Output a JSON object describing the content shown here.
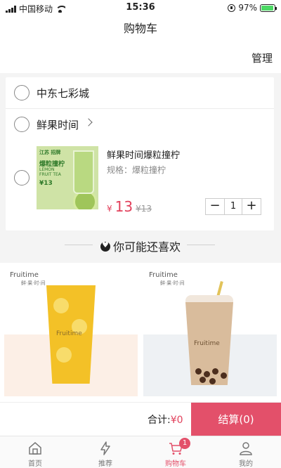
{
  "status_bar": {
    "carrier": "中国移动",
    "time": "15:36",
    "battery": "97%",
    "battery_level": 0.97
  },
  "header": {
    "title": "购物车"
  },
  "manage": {
    "label": "管理"
  },
  "cart": {
    "store": {
      "name": "中东七彩城"
    },
    "shop": {
      "name": "鲜果时间"
    },
    "item": {
      "title": "鲜果时间爆粒撞柠",
      "spec": "规格：爆粒撞柠",
      "price_symbol": "¥",
      "price": "13",
      "old_price": "¥13",
      "quantity": "1",
      "image_text": {
        "tag": "江苏 招牌",
        "name": "爆粒撞柠",
        "sub": "LEMON FRUIT TEA",
        "price": "¥13"
      }
    }
  },
  "recommend": {
    "title": "你可能还喜欢",
    "cards": [
      {
        "brand": "Fruitime",
        "brand_sub": "鲜·果·时·间",
        "cup_text": "Fruitime"
      },
      {
        "brand": "Fruitime",
        "brand_sub": "鲜·果·时·间",
        "cup_text": "Fruitime"
      }
    ]
  },
  "checkout": {
    "total_label": "合计:",
    "total_value": "¥0",
    "button": "结算(0)"
  },
  "tabbar": {
    "items": [
      {
        "label": "首页",
        "icon": "home-icon"
      },
      {
        "label": "推荐",
        "icon": "lightning-icon"
      },
      {
        "label": "购物车",
        "icon": "cart-icon",
        "badge": "1"
      },
      {
        "label": "我的",
        "icon": "user-icon"
      }
    ]
  },
  "colors": {
    "accent": "#e3506a",
    "price": "#e2415c"
  }
}
